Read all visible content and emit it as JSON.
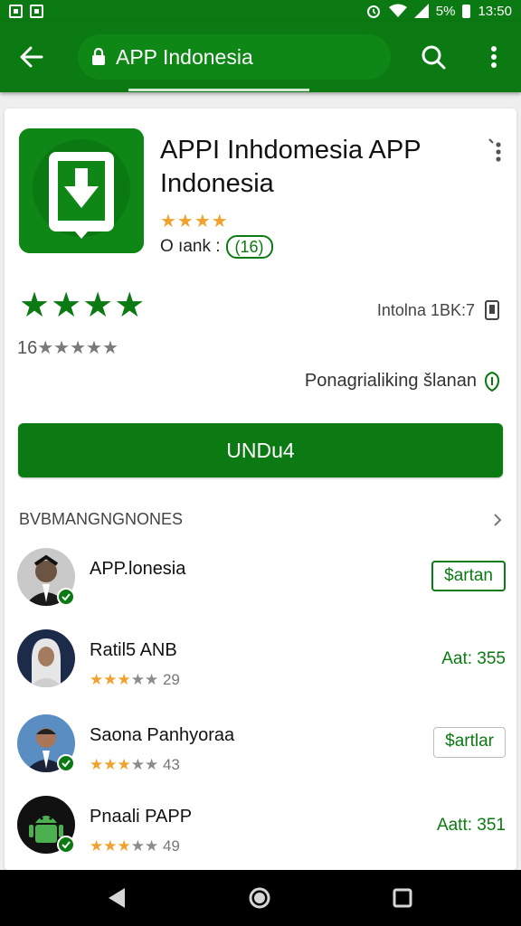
{
  "status_bar": {
    "battery": "5%",
    "time": "13:50"
  },
  "search": {
    "text": "APP Indonesia"
  },
  "app": {
    "title": "APPI Inhdomesia APP Indonesia",
    "stars": "★★★★",
    "rank_label": "O ıank :",
    "rank_value": "(16)",
    "big_stars": "★★★★",
    "rating_count_prefix": "16",
    "rating_count_stars": "★★★★★",
    "meta": "Intolna 1BK:7",
    "permissions": "Ponagrialiking šlanan",
    "download_label": "UNDu4"
  },
  "section": {
    "title": "BVBMANGNGNONES"
  },
  "list": [
    {
      "name": "APP.lonesia",
      "rating": "",
      "button": "$artan",
      "right_text": ""
    },
    {
      "name": "Ratil5 ANB",
      "rating": "29",
      "button": "",
      "right_text": "Aat: 355"
    },
    {
      "name": "Saona Panhyoraa",
      "rating": "43",
      "button": "$artlar",
      "right_text": ""
    },
    {
      "name": "Pnaali PAPP",
      "rating": "49",
      "button": "",
      "right_text": "Aatt: 351"
    }
  ],
  "colors": {
    "brand": "#0b7a12",
    "star": "#f1a12e"
  }
}
